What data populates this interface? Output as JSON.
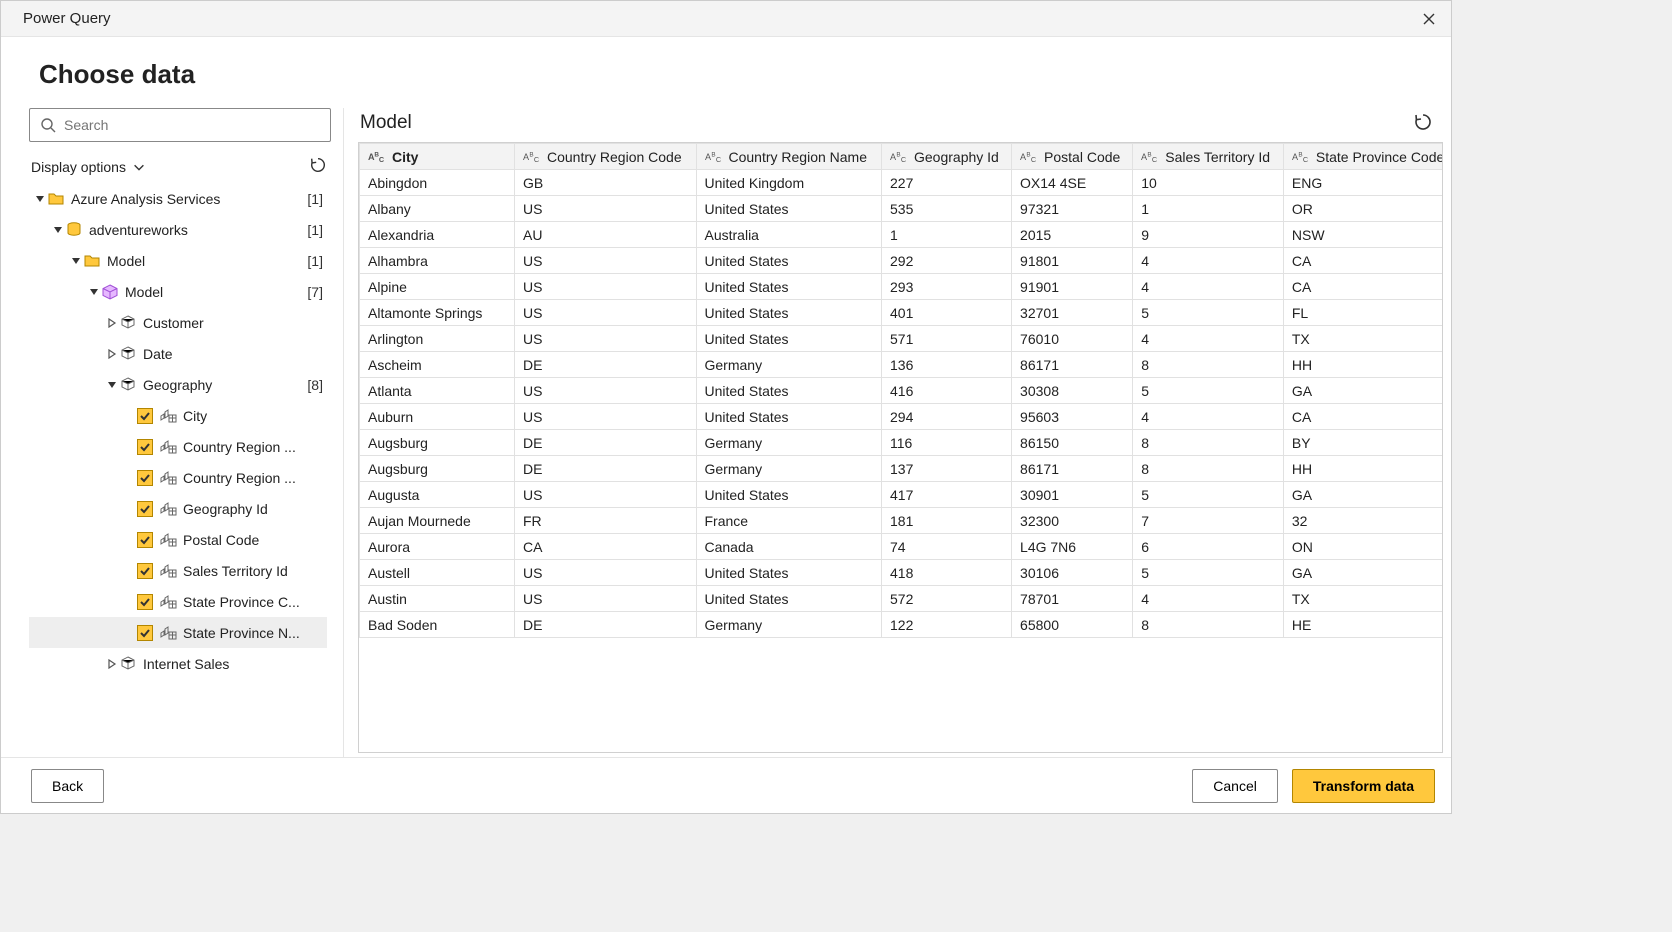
{
  "titlebar": "Power Query",
  "heading": "Choose data",
  "search_placeholder": "Search",
  "display_options_label": "Display options",
  "tree": [
    {
      "level": 1,
      "expanded": true,
      "icon": "folder-yellow",
      "label": "Azure Analysis Services",
      "count": "[1]"
    },
    {
      "level": 2,
      "expanded": true,
      "icon": "database",
      "label": "adventureworks",
      "count": "[1]"
    },
    {
      "level": 3,
      "expanded": true,
      "icon": "folder-yellow",
      "label": "Model",
      "count": "[1]"
    },
    {
      "level": 4,
      "expanded": true,
      "icon": "cube",
      "label": "Model",
      "count": "[7]"
    },
    {
      "level": 5,
      "expanded": false,
      "arrow": "right",
      "icon": "table",
      "label": "Customer"
    },
    {
      "level": 5,
      "expanded": false,
      "arrow": "right",
      "icon": "table",
      "label": "Date"
    },
    {
      "level": 5,
      "expanded": true,
      "arrow": "down",
      "icon": "table",
      "label": "Geography",
      "count": "[8]"
    },
    {
      "level": 6,
      "checked": true,
      "icon": "column",
      "label": "City"
    },
    {
      "level": 6,
      "checked": true,
      "icon": "column",
      "label": "Country Region ..."
    },
    {
      "level": 6,
      "checked": true,
      "icon": "column",
      "label": "Country Region ..."
    },
    {
      "level": 6,
      "checked": true,
      "icon": "column",
      "label": "Geography Id"
    },
    {
      "level": 6,
      "checked": true,
      "icon": "column",
      "label": "Postal Code"
    },
    {
      "level": 6,
      "checked": true,
      "icon": "column",
      "label": "Sales Territory Id"
    },
    {
      "level": 6,
      "checked": true,
      "icon": "column",
      "label": "State Province C..."
    },
    {
      "level": 6,
      "checked": true,
      "icon": "column",
      "label": "State Province N...",
      "selected": true
    },
    {
      "level": 5,
      "expanded": false,
      "arrow": "right",
      "icon": "table",
      "label": "Internet Sales"
    }
  ],
  "preview_title": "Model",
  "columns": [
    "City",
    "Country Region Code",
    "Country Region Name",
    "Geography Id",
    "Postal Code",
    "Sales Territory Id",
    "State Province Code"
  ],
  "rows": [
    [
      "Abingdon",
      "GB",
      "United Kingdom",
      "227",
      "OX14 4SE",
      "10",
      "ENG"
    ],
    [
      "Albany",
      "US",
      "United States",
      "535",
      "97321",
      "1",
      "OR"
    ],
    [
      "Alexandria",
      "AU",
      "Australia",
      "1",
      "2015",
      "9",
      "NSW"
    ],
    [
      "Alhambra",
      "US",
      "United States",
      "292",
      "91801",
      "4",
      "CA"
    ],
    [
      "Alpine",
      "US",
      "United States",
      "293",
      "91901",
      "4",
      "CA"
    ],
    [
      "Altamonte Springs",
      "US",
      "United States",
      "401",
      "32701",
      "5",
      "FL"
    ],
    [
      "Arlington",
      "US",
      "United States",
      "571",
      "76010",
      "4",
      "TX"
    ],
    [
      "Ascheim",
      "DE",
      "Germany",
      "136",
      "86171",
      "8",
      "HH"
    ],
    [
      "Atlanta",
      "US",
      "United States",
      "416",
      "30308",
      "5",
      "GA"
    ],
    [
      "Auburn",
      "US",
      "United States",
      "294",
      "95603",
      "4",
      "CA"
    ],
    [
      "Augsburg",
      "DE",
      "Germany",
      "116",
      "86150",
      "8",
      "BY"
    ],
    [
      "Augsburg",
      "DE",
      "Germany",
      "137",
      "86171",
      "8",
      "HH"
    ],
    [
      "Augusta",
      "US",
      "United States",
      "417",
      "30901",
      "5",
      "GA"
    ],
    [
      "Aujan Mournede",
      "FR",
      "France",
      "181",
      "32300",
      "7",
      "32"
    ],
    [
      "Aurora",
      "CA",
      "Canada",
      "74",
      "L4G 7N6",
      "6",
      "ON"
    ],
    [
      "Austell",
      "US",
      "United States",
      "418",
      "30106",
      "5",
      "GA"
    ],
    [
      "Austin",
      "US",
      "United States",
      "572",
      "78701",
      "4",
      "TX"
    ],
    [
      "Bad Soden",
      "DE",
      "Germany",
      "122",
      "65800",
      "8",
      "HE"
    ]
  ],
  "buttons": {
    "back": "Back",
    "cancel": "Cancel",
    "transform": "Transform data"
  }
}
